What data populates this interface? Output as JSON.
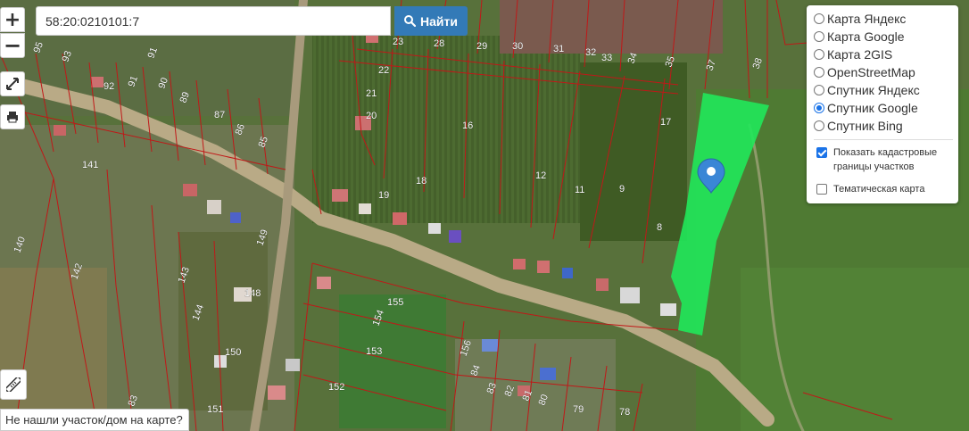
{
  "search": {
    "value": "58:20:0210101:7",
    "button_label": "Найти"
  },
  "zoom": {
    "in_label": "+",
    "out_label": "−"
  },
  "layers": {
    "items": [
      {
        "label": "Карта Яндекс",
        "selected": false
      },
      {
        "label": "Карта Google",
        "selected": false
      },
      {
        "label": "Карта 2GIS",
        "selected": false
      },
      {
        "label": "OpenStreetMap",
        "selected": false
      },
      {
        "label": "Спутник Яндекс",
        "selected": false
      },
      {
        "label": "Спутник Google",
        "selected": true
      },
      {
        "label": "Спутник Bing",
        "selected": false
      }
    ],
    "show_cadastral_label": "Показать кадастровые границы участков",
    "show_cadastral_checked": true,
    "thematic_label": "Тематическая карта",
    "thematic_checked": false
  },
  "notice": "Не нашли участок/дом на карте?",
  "parcel_labels": [
    "95",
    "93",
    "91",
    "92",
    "91",
    "90",
    "89",
    "87",
    "86",
    "85",
    "141",
    "140",
    "142",
    "143",
    "144",
    "148",
    "149",
    "150",
    "151",
    "83",
    "23",
    "28",
    "29",
    "30",
    "31",
    "32",
    "33",
    "34",
    "35",
    "37",
    "38",
    "22",
    "21",
    "20",
    "16",
    "18",
    "19",
    "12",
    "11",
    "9",
    "8",
    "17",
    "155",
    "154",
    "153",
    "152",
    "156",
    "84",
    "83",
    "82",
    "81",
    "80",
    "79",
    "78"
  ],
  "colors": {
    "parcel_highlight": "#20e85a",
    "boundary": "#c01818",
    "marker": "#3a86d6",
    "accent": "#337ab7"
  },
  "icons": {
    "search": "search-icon",
    "fullscreen": "expand-icon",
    "print": "printer-icon",
    "ruler": "ruler-icon",
    "marker": "map-marker-icon"
  }
}
